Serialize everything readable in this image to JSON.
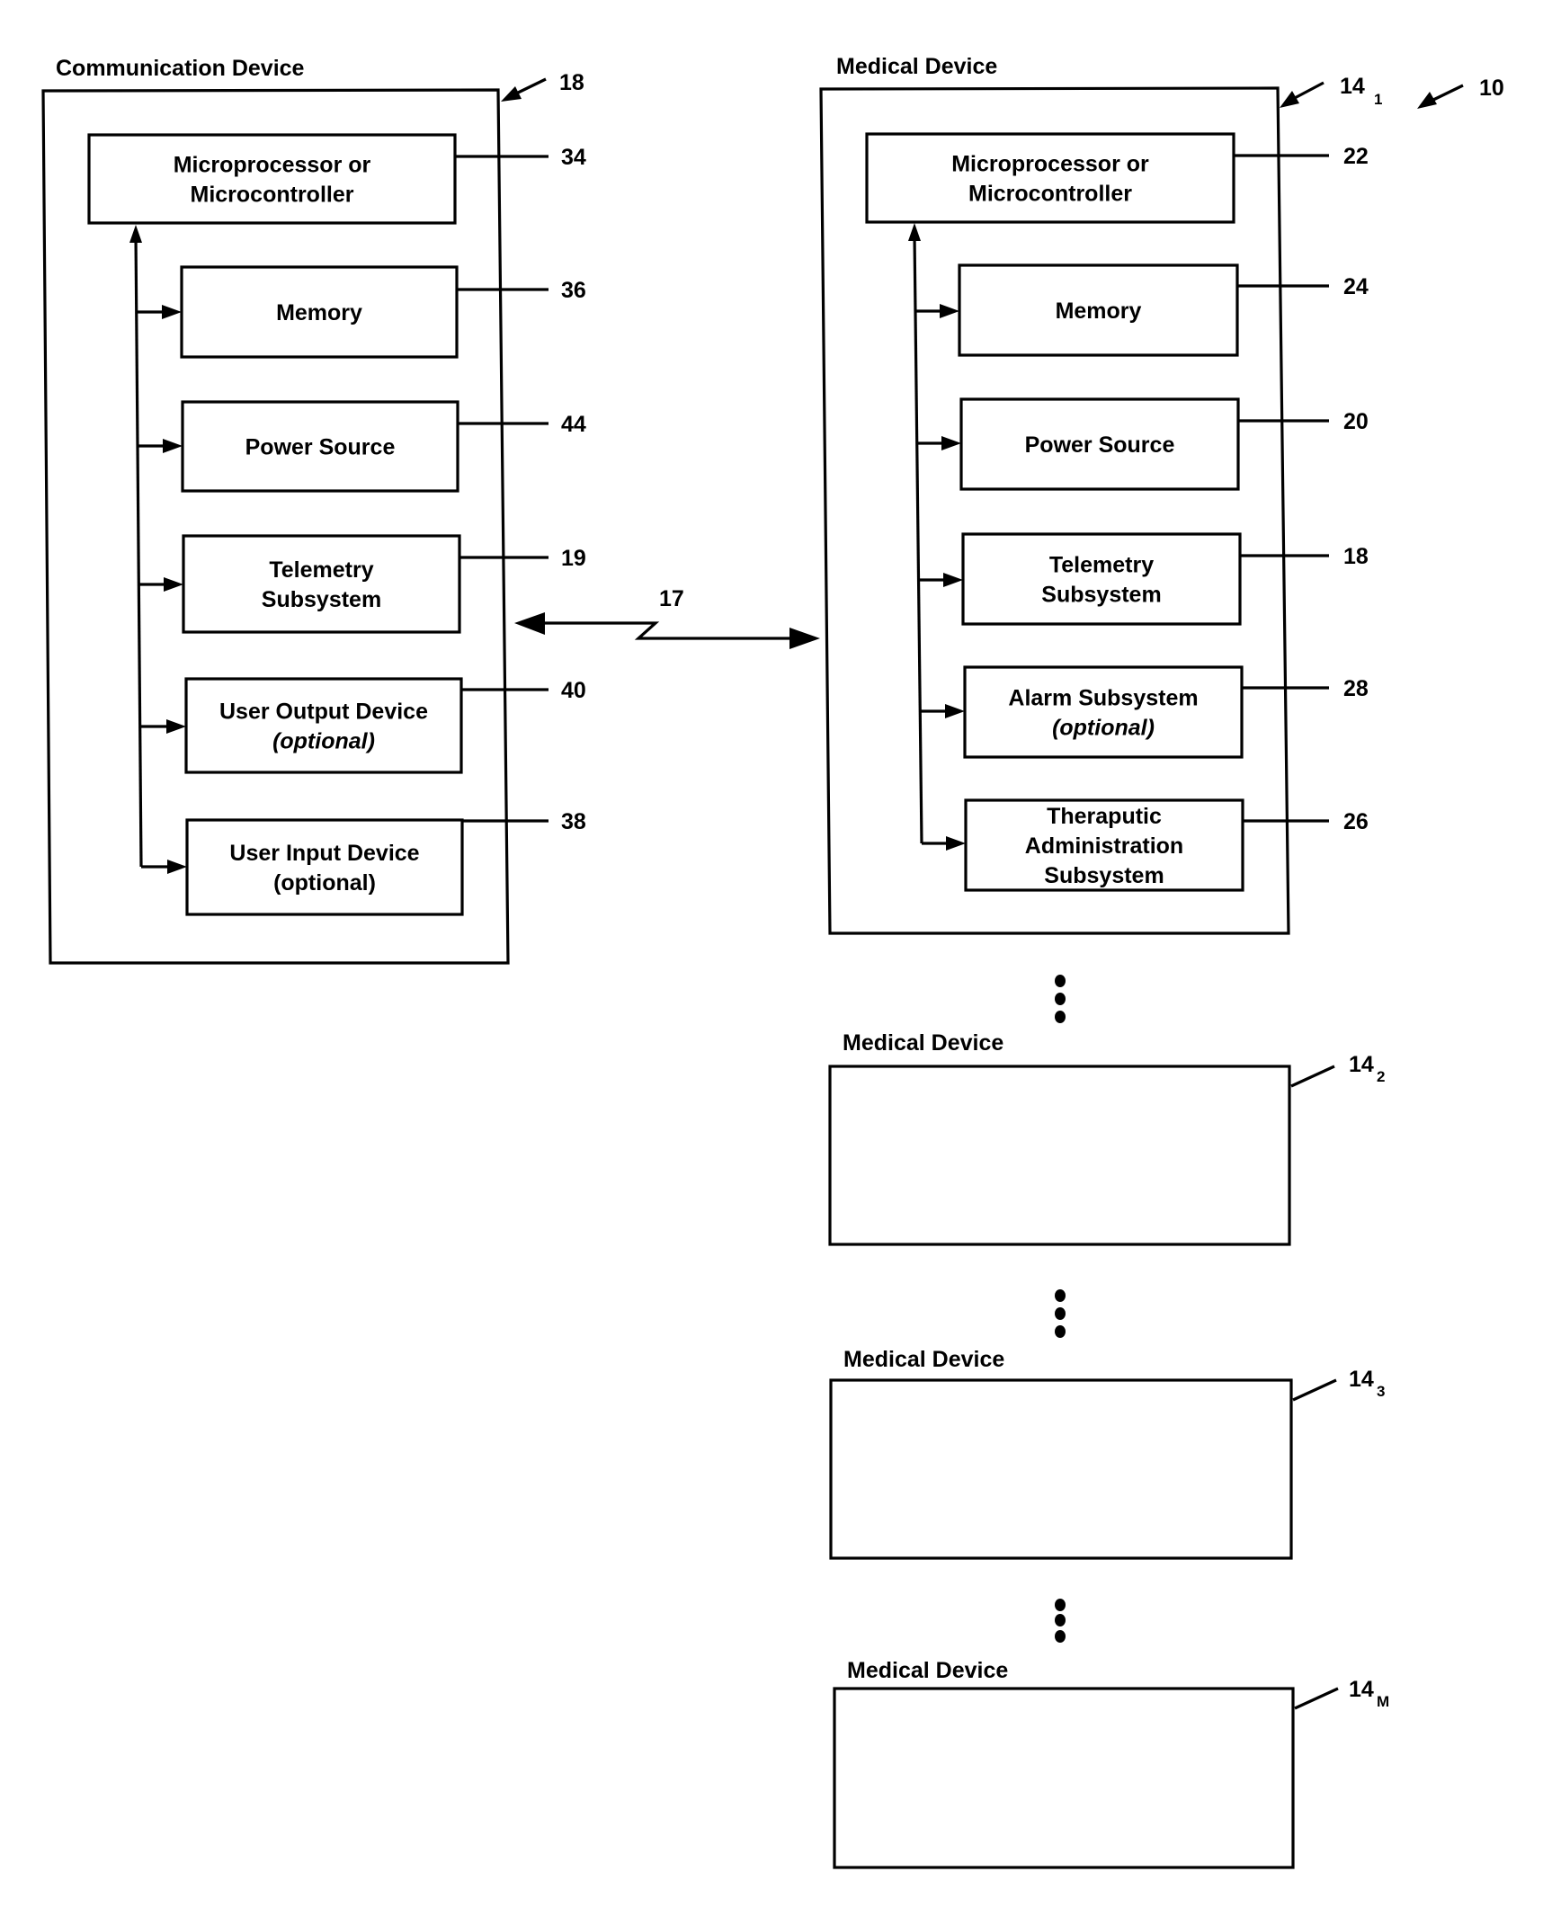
{
  "figure": {
    "system_ref": "10",
    "link_ref": "17"
  },
  "communication_device": {
    "title": "Communication Device",
    "ref": "18",
    "blocks": [
      {
        "lines": [
          "Microprocessor or",
          "Microcontroller"
        ],
        "ref": "34",
        "italic_line": null
      },
      {
        "lines": [
          "Memory"
        ],
        "ref": "36",
        "italic_line": null
      },
      {
        "lines": [
          "Power Source"
        ],
        "ref": "44",
        "italic_line": null
      },
      {
        "lines": [
          "Telemetry",
          "Subsystem"
        ],
        "ref": "19",
        "italic_line": null
      },
      {
        "lines": [
          "User Output Device",
          "(optional)"
        ],
        "ref": "40",
        "italic_line": 1
      },
      {
        "lines": [
          "User Input Device",
          "(optional)"
        ],
        "ref": "38",
        "italic_line": null
      }
    ]
  },
  "medical_device_1": {
    "title": "Medical Device",
    "ref": "14",
    "ref_sub": "1",
    "blocks": [
      {
        "lines": [
          "Microprocessor or",
          "Microcontroller"
        ],
        "ref": "22",
        "italic_line": null
      },
      {
        "lines": [
          "Memory"
        ],
        "ref": "24",
        "italic_line": null
      },
      {
        "lines": [
          "Power Source"
        ],
        "ref": "20",
        "italic_line": null
      },
      {
        "lines": [
          "Telemetry",
          "Subsystem"
        ],
        "ref": "18",
        "italic_line": null
      },
      {
        "lines": [
          "Alarm Subsystem",
          "(optional)"
        ],
        "ref": "28",
        "italic_line": 1
      },
      {
        "lines": [
          "Theraputic",
          "Administration",
          "Subsystem"
        ],
        "ref": "26",
        "italic_line": null
      }
    ]
  },
  "other_medical_devices": [
    {
      "title": "Medical Device",
      "ref": "14",
      "ref_sub": "2"
    },
    {
      "title": "Medical Device",
      "ref": "14",
      "ref_sub": "3"
    },
    {
      "title": "Medical Device",
      "ref": "14",
      "ref_sub": "M"
    }
  ]
}
